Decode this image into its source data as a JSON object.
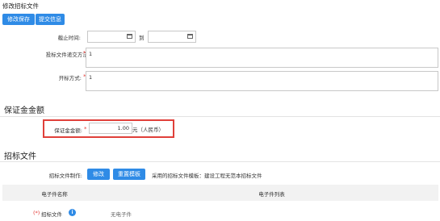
{
  "page": {
    "title": "修改招标文件"
  },
  "toolbar": {
    "save_label": "修改保存",
    "submit_label": "提交信息"
  },
  "form": {
    "bid_deadline": {
      "label": "截止时间:",
      "start_value": "",
      "to_label": "到",
      "end_value": ""
    },
    "delivery_method": {
      "label": "投标文件递交方法:",
      "value": "1"
    },
    "bid_opening": {
      "label": "开标方式:",
      "value": "1"
    }
  },
  "deposit": {
    "section_title": "保证金金额",
    "label": "保证金金额:",
    "value": "1.00",
    "unit": "元（人民币）"
  },
  "bid_docs": {
    "section_title": "招标文件",
    "make_label": "招标文件制作:",
    "modify_button": "修改",
    "reset_button": "重置模板",
    "template_text": "采用的招标文件模板：建设工程无范本招标文件",
    "table": {
      "headers": [
        "电子件名称",
        "电子件列表"
      ],
      "rows": [
        {
          "required_mark": "(*)",
          "name": "招标文件",
          "files": "无电子件"
        }
      ]
    }
  },
  "colors": {
    "accent": "#2f8be6",
    "required": "#e53935",
    "highlight_box": "#e0403a"
  }
}
